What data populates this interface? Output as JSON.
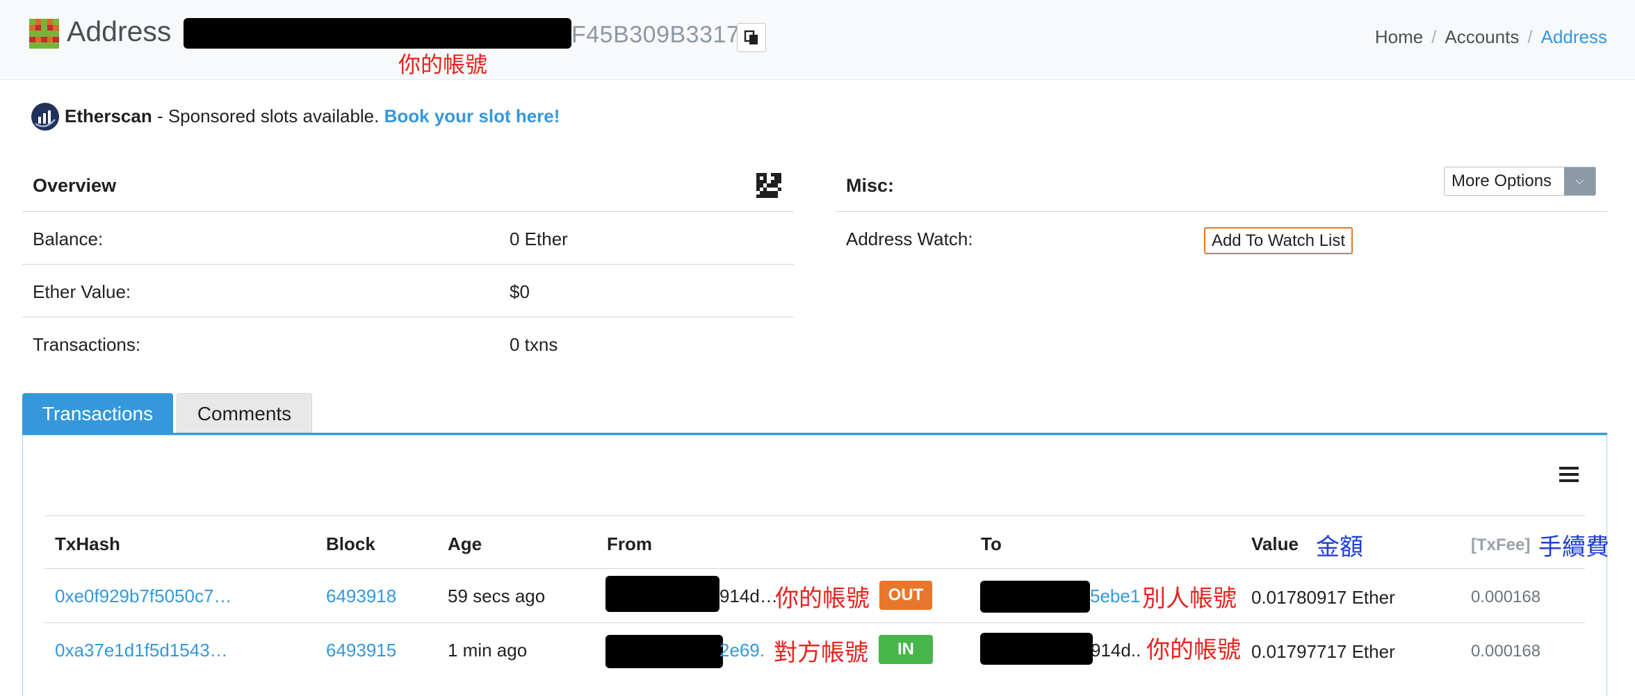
{
  "header": {
    "title": "Address",
    "address_tail": "F45B309B3317",
    "annotation_your_account": "你的帳號",
    "breadcrumb": [
      "Home",
      "Accounts",
      "Address"
    ]
  },
  "sponsor": {
    "brand": "Etherscan",
    "text": " - Sponsored slots available. ",
    "link": "Book your slot here!"
  },
  "overview": {
    "title": "Overview",
    "rows": [
      {
        "label": "Balance:",
        "value": "0 Ether"
      },
      {
        "label": "Ether Value:",
        "value": "$0"
      },
      {
        "label": "Transactions:",
        "value": "0 txns"
      }
    ]
  },
  "misc": {
    "title": "Misc:",
    "more_options": "More Options",
    "watch_label": "Address Watch:",
    "watch_button": "Add To Watch List"
  },
  "tabs": [
    "Transactions",
    "Comments"
  ],
  "table": {
    "headers": [
      "TxHash",
      "Block",
      "Age",
      "From",
      "To",
      "Value",
      "[TxFee]"
    ],
    "value_annotation": "金額",
    "fee_annotation": "手續費",
    "rows": [
      {
        "hash": "0xe0f929b7f5050c7…",
        "block": "6493918",
        "age": "59 secs ago",
        "from_tail": "914d…",
        "from_note": "你的帳號",
        "direction": "OUT",
        "to_tail": "5ebe1",
        "to_note": "別人帳號",
        "value": "0.01780917 Ether",
        "fee": "0.000168"
      },
      {
        "hash": "0xa37e1d1f5d1543…",
        "block": "6493915",
        "age": "1 min ago",
        "from_tail": "2e69.",
        "from_note": "對方帳號",
        "direction": "IN",
        "to_tail": "914d..",
        "to_note": "你的帳號",
        "value": "0.01797717 Ether",
        "fee": "0.000168"
      }
    ]
  },
  "colors": {
    "accent": "#3498db",
    "out_badge": "#e8762b",
    "in_badge": "#47b54a",
    "annotation_red": "#e8231e",
    "annotation_blue": "#1f3fd6"
  },
  "icons": [
    "identicon-icon",
    "copy-icon",
    "etherscan-logo-icon",
    "qr-code-icon",
    "chevron-down-icon",
    "menu-icon"
  ]
}
